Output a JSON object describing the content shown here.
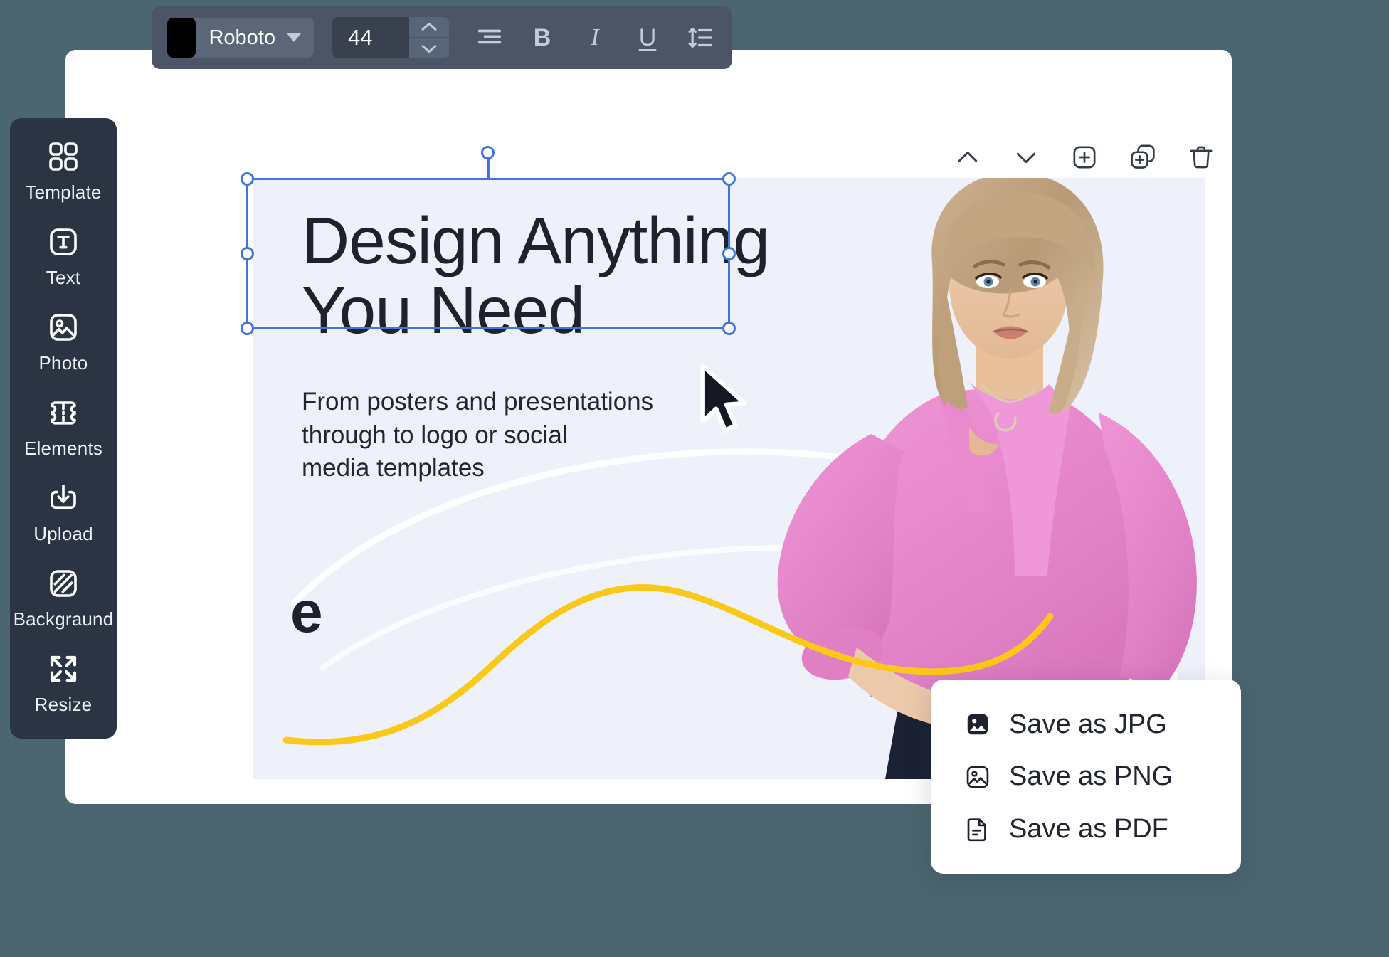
{
  "theme": {
    "page_background": "#4b6670",
    "panel_background": "#ffffff",
    "toolbar_background": "#4b5565",
    "sidebar_background": "#2b3442",
    "canvas_background": "#eef1fa",
    "accent_selection": "#4074e0",
    "accent_yellow": "#fac819",
    "text_dark": "#1d222e",
    "blouse_pink": "#e88ad0"
  },
  "text_toolbar": {
    "color_swatch_value": "#000000",
    "font_family_value": "Roboto",
    "font_family_caret": "chevron-down-icon",
    "font_size_value": "44",
    "spinner_up": "chevron-up-icon",
    "spinner_down": "chevron-down-icon",
    "buttons": [
      {
        "name": "align-text-button",
        "icon": "align-right-icon",
        "label": ""
      },
      {
        "name": "bold-button",
        "icon": "bold-icon",
        "label": "B"
      },
      {
        "name": "italic-button",
        "icon": "italic-icon",
        "label": "I"
      },
      {
        "name": "underline-button",
        "icon": "underline-icon",
        "label": "U"
      },
      {
        "name": "line-height-button",
        "icon": "line-spacing-icon",
        "label": ""
      }
    ]
  },
  "object_tools": [
    {
      "name": "move-up-button",
      "icon": "chevron-up-icon"
    },
    {
      "name": "move-down-button",
      "icon": "chevron-down-icon"
    },
    {
      "name": "add-element-button",
      "icon": "plus-square-icon"
    },
    {
      "name": "duplicate-button",
      "icon": "duplicate-icon"
    },
    {
      "name": "delete-button",
      "icon": "trash-icon"
    }
  ],
  "sidebar": {
    "items": [
      {
        "label": "Template",
        "icon": "grid-squares-icon"
      },
      {
        "label": "Text",
        "icon": "text-box-icon"
      },
      {
        "label": "Photo",
        "icon": "image-icon"
      },
      {
        "label": "Elements",
        "icon": "ticket-icon"
      },
      {
        "label": "Upload",
        "icon": "upload-icon"
      },
      {
        "label": "Backgraund",
        "icon": "pattern-square-icon"
      },
      {
        "label": "Resize",
        "icon": "expand-arrows-icon"
      }
    ]
  },
  "canvas": {
    "headline": "Design Anything\nYou Need",
    "subcopy": "From posters and presentations\nthrough to logo or social\nmedia templates",
    "logo_mark": "e",
    "selection": {
      "visible": true,
      "handles": [
        "top-left",
        "top-right",
        "middle-left",
        "middle-right",
        "bottom-left",
        "bottom-right",
        "rotate"
      ]
    },
    "cursor": "arrow-pointer"
  },
  "save_menu": {
    "items": [
      {
        "label": "Save as JPG",
        "icon": "image-filled-icon"
      },
      {
        "label": "Save as PNG",
        "icon": "image-outline-icon"
      },
      {
        "label": "Save as PDF",
        "icon": "document-icon"
      }
    ]
  }
}
